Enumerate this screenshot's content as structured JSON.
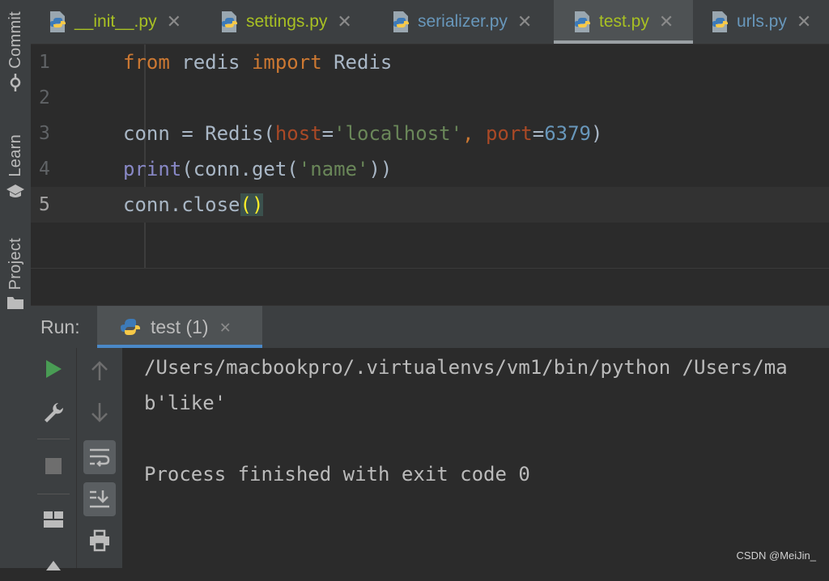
{
  "sidebar": {
    "commit_label": "Commit",
    "learn_label": "Learn",
    "project_label": "Project"
  },
  "tabs": [
    {
      "label": "__init__.py",
      "color": "#a8c023",
      "active": false
    },
    {
      "label": "settings.py",
      "color": "#a8c023",
      "active": false
    },
    {
      "label": "serializer.py",
      "color": "#6897bb",
      "active": false
    },
    {
      "label": "test.py",
      "color": "#a8c023",
      "active": true
    },
    {
      "label": "urls.py",
      "color": "#6897bb",
      "active": false
    }
  ],
  "editor": {
    "line_numbers": [
      "1",
      "2",
      "3",
      "4",
      "5"
    ],
    "lines": {
      "l1": {
        "kw1": "from",
        "mod": " redis ",
        "kw2": "import",
        "cls": " Redis"
      },
      "l3": {
        "a": "conn = Redis(",
        "p1": "host",
        "eq1": "=",
        "s1": "'localhost'",
        "comma": ", ",
        "p2": "port",
        "eq2": "=",
        "n1": "6379",
        "close": ")"
      },
      "l4": {
        "fn": "print",
        "a": "(conn.get(",
        "s1": "'name'",
        "b": "))"
      },
      "l5": {
        "a": "conn.close",
        "paren": "()"
      }
    },
    "current_line": 5
  },
  "run": {
    "label": "Run:",
    "tab_name": "test (1)"
  },
  "console": {
    "lines": [
      "/Users/macbookpro/.virtualenvs/vm1/bin/python /Users/ma",
      "b'like'",
      "",
      "Process finished with exit code 0"
    ]
  },
  "colors": {
    "accent_blue": "#4a88c7",
    "run_green": "#499c54"
  },
  "watermark": "CSDN @MeiJin_"
}
